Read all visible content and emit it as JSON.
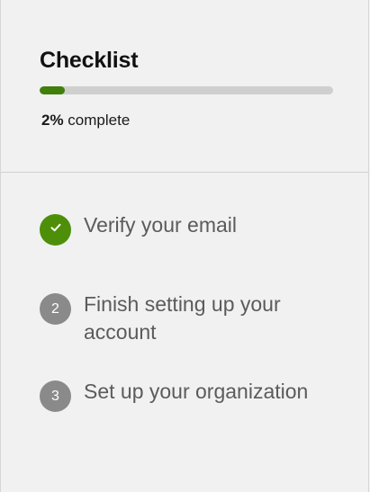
{
  "checklist": {
    "title": "Checklist",
    "progress": {
      "percent": 2,
      "percent_label": "2%",
      "suffix": " complete",
      "track_color": "#cfcfcf",
      "fill_color": "#3f7f0a"
    },
    "steps": [
      {
        "number": "",
        "label": "Verify your email",
        "status": "done",
        "icon": "checkmark-icon"
      },
      {
        "number": "2",
        "label": "Finish setting up your account",
        "status": "pending",
        "icon": "step-number"
      },
      {
        "number": "3",
        "label": "Set up your organization",
        "status": "pending",
        "icon": "step-number"
      }
    ]
  }
}
